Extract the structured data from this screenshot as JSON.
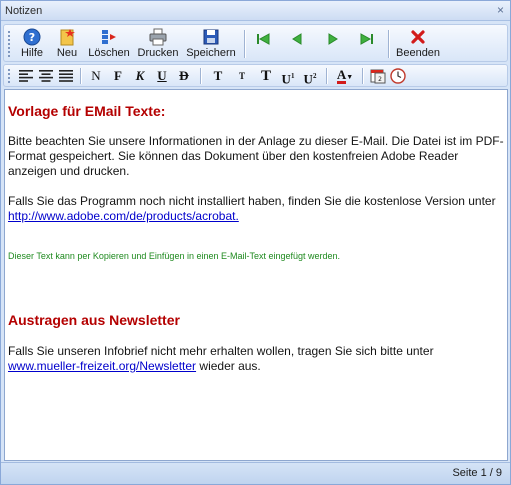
{
  "window": {
    "title": "Notizen",
    "close_glyph": "×"
  },
  "toolbar": {
    "hilfe": "Hilfe",
    "neu": "Neu",
    "loeschen": "Löschen",
    "drucken": "Drucken",
    "speichern": "Speichern",
    "beenden": "Beenden"
  },
  "format": {
    "normal": "N",
    "bold": "F",
    "italic": "K",
    "underline": "U",
    "strike": "D",
    "bigger": "T",
    "smaller": "T",
    "tt": "T",
    "superscript_base": "U",
    "superscript_mark": "1",
    "sub_base": "U",
    "sub_mark": "2",
    "font_color": "A"
  },
  "content": {
    "heading1": "Vorlage für EMail Texte:",
    "para1": "Bitte beachten Sie unsere Informationen in der Anlage zu dieser E-Mail. Die Datei ist im PDF-Format gespeichert. Sie können das Dokument über den kostenfreien Adobe Reader anzeigen und drucken.",
    "para2_text": "Falls Sie das Programm noch nicht installiert haben, finden Sie die kostenlose Version unter ",
    "para2_link": "http://www.adobe.com/de/products/acrobat.",
    "note": "Dieser Text kann per Kopieren und Einfügen in einen E-Mail-Text eingefügt werden.",
    "heading2": "Austragen aus Newsletter",
    "para3_text": "Falls Sie unseren Infobrief nicht mehr erhalten wollen, tragen Sie sich bitte unter ",
    "para3_link": "www.mueller-freizeit.org/Newsletter",
    "para3_tail": " wieder aus."
  },
  "status": {
    "page": "Seite 1 / 9"
  },
  "colors": {
    "heading": "#b40000",
    "link": "#0000cc",
    "note": "#1f8a1f",
    "chrome": "#d6e4f7"
  }
}
